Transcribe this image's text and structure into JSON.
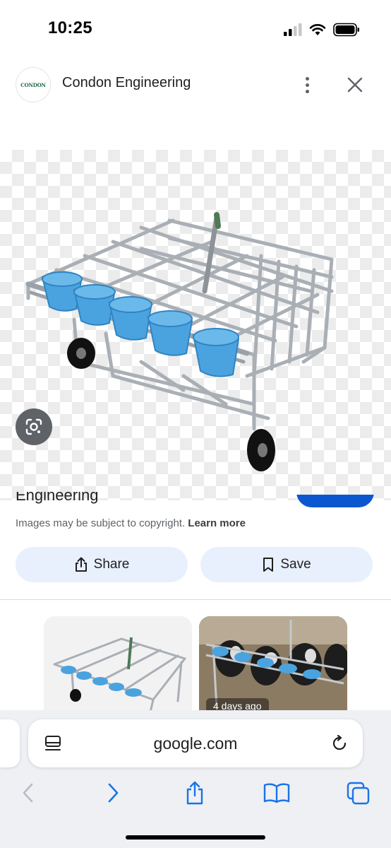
{
  "status_bar": {
    "time": "10:25"
  },
  "header": {
    "logo_text": "CONDON",
    "site_name": "Condon Engineering"
  },
  "image": {
    "subject": "calf-feeding-cart"
  },
  "info": {
    "partial_title": "Engineering",
    "copyright_text": "Images may be subject to copyright.",
    "learn_more": "Learn more"
  },
  "actions": {
    "share_label": "Share",
    "save_label": "Save"
  },
  "related": [
    {
      "badge": ""
    },
    {
      "badge": "4 days ago"
    }
  ],
  "browser": {
    "url": "google.com"
  },
  "colors": {
    "accent": "#0b57d0",
    "button_bg": "#e8f0fe",
    "chrome_bg": "#eef0f3",
    "toolbar_icon": "#1a73e8"
  },
  "icons": [
    "signal-icon",
    "wifi-icon",
    "battery-icon",
    "more-icon",
    "close-icon",
    "lens-icon",
    "share-icon",
    "bookmark-icon",
    "page-menu-icon",
    "reload-icon",
    "back-icon",
    "forward-icon",
    "share-sheet-icon",
    "bookmarks-icon",
    "tabs-icon"
  ]
}
